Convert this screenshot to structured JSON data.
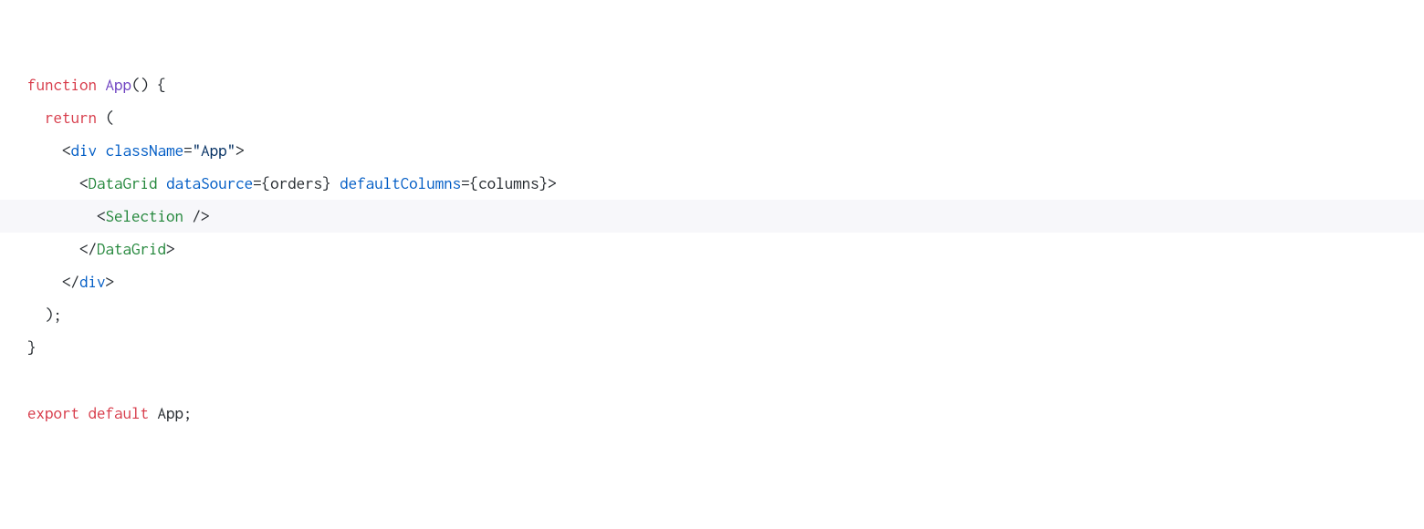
{
  "code": {
    "lines": [
      {
        "indent": 0,
        "tokens": [
          {
            "text": "function",
            "cls": "kw-red"
          },
          {
            "text": " ",
            "cls": "default"
          },
          {
            "text": "App",
            "cls": "fn-purple"
          },
          {
            "text": "() {",
            "cls": "punct"
          }
        ],
        "highlighted": false
      },
      {
        "indent": 1,
        "tokens": [
          {
            "text": "return",
            "cls": "kw-red"
          },
          {
            "text": " (",
            "cls": "punct"
          }
        ],
        "highlighted": false
      },
      {
        "indent": 2,
        "tokens": [
          {
            "text": "<",
            "cls": "punct"
          },
          {
            "text": "div",
            "cls": "tag-blue"
          },
          {
            "text": " ",
            "cls": "default"
          },
          {
            "text": "className",
            "cls": "attr-blue"
          },
          {
            "text": "=",
            "cls": "punct"
          },
          {
            "text": "\"App\"",
            "cls": "string"
          },
          {
            "text": ">",
            "cls": "punct"
          }
        ],
        "highlighted": false
      },
      {
        "indent": 3,
        "tokens": [
          {
            "text": "<",
            "cls": "punct"
          },
          {
            "text": "DataGrid",
            "cls": "tag-green"
          },
          {
            "text": " ",
            "cls": "default"
          },
          {
            "text": "dataSource",
            "cls": "attr-blue"
          },
          {
            "text": "=",
            "cls": "punct"
          },
          {
            "text": "{orders}",
            "cls": "default"
          },
          {
            "text": " ",
            "cls": "default"
          },
          {
            "text": "defaultColumns",
            "cls": "attr-blue"
          },
          {
            "text": "=",
            "cls": "punct"
          },
          {
            "text": "{columns}>",
            "cls": "default"
          }
        ],
        "highlighted": false
      },
      {
        "indent": 4,
        "tokens": [
          {
            "text": "<",
            "cls": "punct"
          },
          {
            "text": "Selection",
            "cls": "tag-green"
          },
          {
            "text": " />",
            "cls": "punct"
          }
        ],
        "highlighted": true
      },
      {
        "indent": 3,
        "tokens": [
          {
            "text": "</",
            "cls": "punct"
          },
          {
            "text": "DataGrid",
            "cls": "tag-green"
          },
          {
            "text": ">",
            "cls": "punct"
          }
        ],
        "highlighted": false
      },
      {
        "indent": 2,
        "tokens": [
          {
            "text": "</",
            "cls": "punct"
          },
          {
            "text": "div",
            "cls": "tag-blue"
          },
          {
            "text": ">",
            "cls": "punct"
          }
        ],
        "highlighted": false
      },
      {
        "indent": 1,
        "tokens": [
          {
            "text": ");",
            "cls": "punct"
          }
        ],
        "highlighted": false
      },
      {
        "indent": 0,
        "tokens": [
          {
            "text": "}",
            "cls": "punct"
          }
        ],
        "highlighted": false
      },
      {
        "indent": 0,
        "tokens": [],
        "highlighted": false
      },
      {
        "indent": 0,
        "tokens": [
          {
            "text": "export",
            "cls": "kw-red"
          },
          {
            "text": " ",
            "cls": "default"
          },
          {
            "text": "default",
            "cls": "kw-red"
          },
          {
            "text": " App;",
            "cls": "default"
          }
        ],
        "highlighted": false
      }
    ]
  }
}
